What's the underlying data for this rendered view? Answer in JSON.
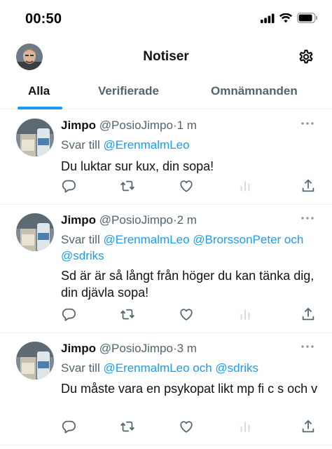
{
  "status_bar": {
    "time": "00:50"
  },
  "header": {
    "title": "Notiser"
  },
  "tabs": [
    {
      "label": "Alla",
      "active": true
    },
    {
      "label": "Verifierade",
      "active": false
    },
    {
      "label": "Omnämnanden",
      "active": false
    }
  ],
  "colors": {
    "accent": "#1d9bf0",
    "text": "#0f1419",
    "muted": "#536471"
  },
  "tweets": [
    {
      "name": "Jimpo",
      "handle": "@PosioJimpo",
      "sep": "·",
      "time": "1 m",
      "reply_prefix": "Svar till",
      "reply_to": "@ErenmalmLeo",
      "text": "Du luktar sur kux, din sopa!"
    },
    {
      "name": "Jimpo",
      "handle": "@PosioJimpo",
      "sep": "·",
      "time": "2 m",
      "reply_prefix": "Svar till",
      "reply_to": "@ErenmalmLeo @BrorssonPeter och @sdriks",
      "text": "Sd är är så långt från höger du kan tänka dig, din djävla sopa!"
    },
    {
      "name": "Jimpo",
      "handle": "@PosioJimpo",
      "sep": "·",
      "time": "3 m",
      "reply_prefix": "Svar till",
      "reply_to": "@ErenmalmLeo och @sdriks",
      "text": "Du måste vara en psykopat likt mp fi c s  och v"
    }
  ],
  "icons": [
    "signal-icon",
    "wifi-icon",
    "battery-icon",
    "gear-icon",
    "more-icon",
    "reply-icon",
    "retweet-icon",
    "like-icon",
    "views-icon",
    "share-icon"
  ]
}
